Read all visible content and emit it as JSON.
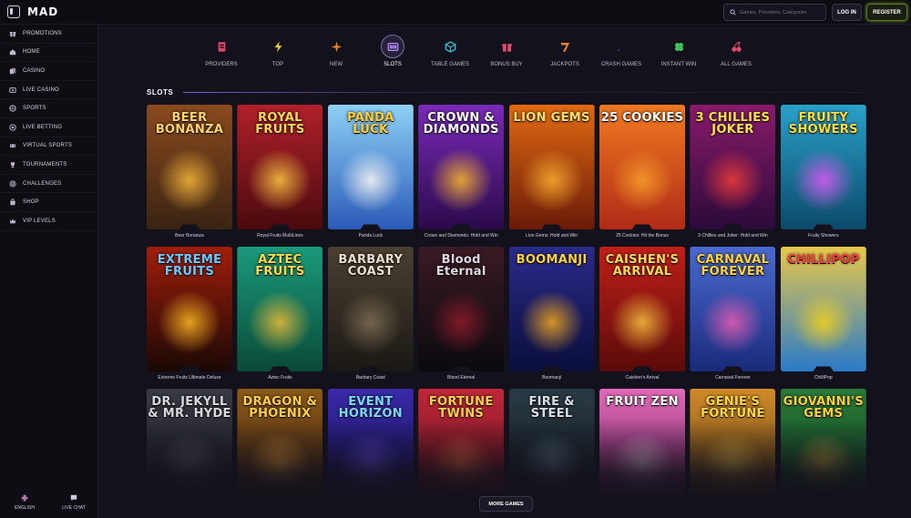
{
  "header": {
    "logo": "MAD",
    "search_placeholder": "Games, Providers, Categories",
    "login_label": "LOG IN",
    "register_label": "REGISTER"
  },
  "sidebar": {
    "items": [
      {
        "label": "PROMOTIONS",
        "icon": "gift-icon"
      },
      {
        "label": "HOME",
        "icon": "home-icon"
      },
      {
        "label": "CASINO",
        "icon": "cards-icon"
      },
      {
        "label": "LIVE CASINO",
        "icon": "live-casino-icon"
      },
      {
        "label": "SPORTS",
        "icon": "ball-icon"
      },
      {
        "label": "LIVE BETTING",
        "icon": "live-betting-icon"
      },
      {
        "label": "VIRTUAL SPORTS",
        "icon": "gamepad-icon"
      },
      {
        "label": "TOURNAMENTS",
        "icon": "trophy-icon"
      },
      {
        "label": "CHALLENGES",
        "icon": "target-icon"
      },
      {
        "label": "SHOP",
        "icon": "shop-icon"
      },
      {
        "label": "VIP LEVELS",
        "icon": "crown-icon"
      }
    ],
    "language_label": "ENGLISH",
    "chat_label": "LIVE CHAT"
  },
  "categories": [
    {
      "label": "PROVIDERS",
      "icon": "providers-icon",
      "color": "#e0446b"
    },
    {
      "label": "TOP",
      "icon": "bolt-icon",
      "color": "#e8d33a"
    },
    {
      "label": "NEW",
      "icon": "star-icon",
      "color": "#e8822a"
    },
    {
      "label": "SLOTS",
      "icon": "slots-icon",
      "color": "#b98cff",
      "active": true
    },
    {
      "label": "TABLE GAMES",
      "icon": "dice-icon",
      "color": "#2ec3d8"
    },
    {
      "label": "BONUS BUY",
      "icon": "gift-icon",
      "color": "#e04a6a"
    },
    {
      "label": "JACKPOTS",
      "icon": "seven-icon",
      "color": "#e8822a"
    },
    {
      "label": "CRASH GAMES",
      "icon": "rocket-icon",
      "color": "#a55cf0"
    },
    {
      "label": "INSTANT WIN",
      "icon": "clover-icon",
      "color": "#3cc25a"
    },
    {
      "label": "ALL GAMES",
      "icon": "cherries-icon",
      "color": "#e04a6a"
    }
  ],
  "section_title": "SLOTS",
  "games": [
    {
      "caption": "Beer Bonanza",
      "logo": "BEER BONANZA",
      "bg1": "#3a2412",
      "bg2": "#8a4a1e",
      "glow": "#f0b23a",
      "logo_color": "#ffd46a"
    },
    {
      "caption": "Royal Fruits MultiLines",
      "logo": "ROYAL FRUITS",
      "bg1": "#4a0a0e",
      "bg2": "#b0202a",
      "glow": "#f5c040",
      "logo_color": "#ffd85a"
    },
    {
      "caption": "Panda Luck",
      "logo": "PANDA LUCK",
      "bg1": "#2a5ab8",
      "bg2": "#8ed0f5",
      "glow": "#f2f2f2",
      "logo_color": "#ffcf3a"
    },
    {
      "caption": "Crown and Diamonds: Hold and Win",
      "logo": "CROWN & DIAMONDS",
      "bg1": "#2a0a4a",
      "bg2": "#7a2ab8",
      "glow": "#f2b030",
      "logo_color": "#ffffff"
    },
    {
      "caption": "Lion Gems: Hold and Win",
      "logo": "LION GEMS",
      "bg1": "#6a1a08",
      "bg2": "#e06a12",
      "glow": "#f5a830",
      "logo_color": "#ffe070"
    },
    {
      "caption": "25 Cookies: Hit the Bonus",
      "logo": "25 COOKIES",
      "bg1": "#b02a16",
      "bg2": "#f07a22",
      "glow": "#f59a2a",
      "logo_color": "#ffffff"
    },
    {
      "caption": "3 Chillies and Joker: Hold and Win",
      "logo": "3 CHILLIES JOKER",
      "bg1": "#2a0a3a",
      "bg2": "#8a1a6a",
      "glow": "#e83a3a",
      "logo_color": "#ffe14a"
    },
    {
      "caption": "Fruity Showers",
      "logo": "FRUITY SHOWERS",
      "bg1": "#0a4a6a",
      "bg2": "#2aa0c8",
      "glow": "#d45af0",
      "logo_color": "#ffde3a"
    },
    {
      "caption": "Extreme Fruits Ultimate Deluxe",
      "logo": "EXTREME FRUITS",
      "bg1": "#1a0806",
      "bg2": "#a01e0a",
      "glow": "#f5b020",
      "logo_color": "#6ac8ff"
    },
    {
      "caption": "Aztec Fruits",
      "logo": "AZTEC FRUITS",
      "bg1": "#0a4a38",
      "bg2": "#1a9a7a",
      "glow": "#e0b83a",
      "logo_color": "#ffd84a"
    },
    {
      "caption": "Barbary Coast",
      "logo": "BARBARY COAST",
      "bg1": "#1a1814",
      "bg2": "#4a4032",
      "glow": "#7a6a52",
      "logo_color": "#e8e0cc"
    },
    {
      "caption": "Blood Eternal",
      "logo": "Blood Eternal",
      "bg1": "#0a0a0e",
      "bg2": "#3a1a24",
      "glow": "#8a1a2a",
      "logo_color": "#e0d8e0"
    },
    {
      "caption": "Boomanji",
      "logo": "BOOMANJI",
      "bg1": "#0a0e3a",
      "bg2": "#2a2a8a",
      "glow": "#e8a020",
      "logo_color": "#ffd23a"
    },
    {
      "caption": "Caishen's Arrival",
      "logo": "CAISHEN'S ARRIVAL",
      "bg1": "#5a0a0a",
      "bg2": "#c02018",
      "glow": "#f0b83a",
      "logo_color": "#ffd85a"
    },
    {
      "caption": "Carnaval Forever",
      "logo": "CARNAVAL FOREVER",
      "bg1": "#1a2a7a",
      "bg2": "#4a6ad0",
      "glow": "#e05ab0",
      "logo_color": "#ffd23a"
    },
    {
      "caption": "ChilliPop",
      "logo": "CHILLIPOP",
      "bg1": "#2a7ac8",
      "bg2": "#e8c84a",
      "glow": "#f0d020",
      "logo_color": "#ff3a3a"
    },
    {
      "caption": "",
      "logo": "DR. JEKYLL & MR. HYDE",
      "bg1": "#141418",
      "bg2": "#3a3a44",
      "glow": "#5a5a66",
      "logo_color": "#d8d8e0"
    },
    {
      "caption": "",
      "logo": "DRAGON & PHOENIX",
      "bg1": "#3a1a0a",
      "bg2": "#8a5a1a",
      "glow": "#f0a030",
      "logo_color": "#ffcf4a"
    },
    {
      "caption": "",
      "logo": "EVENT HORIZON",
      "bg1": "#0a0a4a",
      "bg2": "#3a2aa8",
      "glow": "#6a4af0",
      "logo_color": "#7ad8ff"
    },
    {
      "caption": "",
      "logo": "FORTUNE TWINS",
      "bg1": "#5a0a14",
      "bg2": "#c0283a",
      "glow": "#f06a3a",
      "logo_color": "#ffd04a"
    },
    {
      "caption": "",
      "logo": "FIRE & STEEL",
      "bg1": "#0e1418",
      "bg2": "#2a3a44",
      "glow": "#5a7a8a",
      "logo_color": "#d8e0e8"
    },
    {
      "caption": "",
      "logo": "FRUIT ZEN",
      "bg1": "#6a1a5a",
      "bg2": "#e06ab8",
      "glow": "#f0c8e8",
      "logo_color": "#ffffff"
    },
    {
      "caption": "",
      "logo": "GENIE'S FORTUNE",
      "bg1": "#5a3a0a",
      "bg2": "#d08a2a",
      "glow": "#f0c040",
      "logo_color": "#ffd84a"
    },
    {
      "caption": "",
      "logo": "GIOVANNI'S GEMS",
      "bg1": "#0a3a1a",
      "bg2": "#2a7a3a",
      "glow": "#c8a03a",
      "logo_color": "#ffcf3a"
    }
  ],
  "more_games_label": "MORE GAMES"
}
